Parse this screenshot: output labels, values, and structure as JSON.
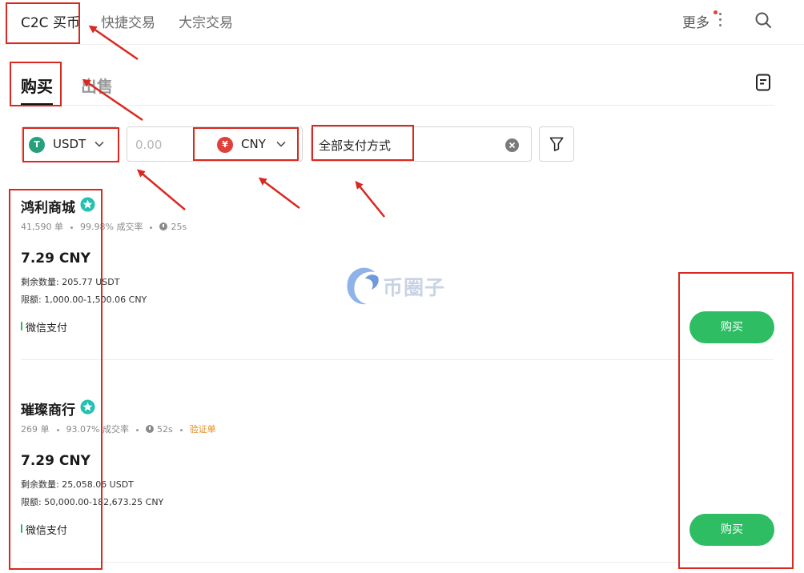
{
  "nav": {
    "tabs": [
      {
        "label": "C2C 买币",
        "active": true
      },
      {
        "label": "快捷交易",
        "active": false
      },
      {
        "label": "大宗交易",
        "active": false
      }
    ],
    "more_label": "更多"
  },
  "trade_tabs": [
    {
      "label": "购买",
      "active": true
    },
    {
      "label": "出售",
      "active": false
    }
  ],
  "filters": {
    "crypto": {
      "label": "USDT",
      "icon_letter": "T",
      "icon_color": "#26a17b"
    },
    "amount": {
      "placeholder": "0.00",
      "value": ""
    },
    "fiat": {
      "label": "CNY",
      "icon_letter": "¥",
      "icon_color": "#e0403a"
    },
    "payment": {
      "label": "全部支付方式"
    }
  },
  "listings": [
    {
      "merchant": "鸿利商城",
      "orders": "41,590 单",
      "completion": "99.98% 成交率",
      "time": "25s",
      "verify": "",
      "price": "7.29 CNY",
      "quantity": "剩余数量: 205.77 USDT",
      "limit": "限额: 1,000.00-1,500.06 CNY",
      "payment": "微信支付",
      "button": "购买"
    },
    {
      "merchant": "璀璨商行",
      "orders": "269 单",
      "completion": "93.07% 成交率",
      "time": "52s",
      "verify": "验证单",
      "price": "7.29 CNY",
      "quantity": "剩余数量: 25,058.06 USDT",
      "limit": "限额: 50,000.00-182,673.25 CNY",
      "payment": "微信支付",
      "button": "购买"
    }
  ],
  "watermark": {
    "text": "币圈子"
  },
  "colors": {
    "accent_green": "#2ebd63",
    "annotation_red": "#d9281f",
    "verify_orange": "#e08a1e"
  }
}
